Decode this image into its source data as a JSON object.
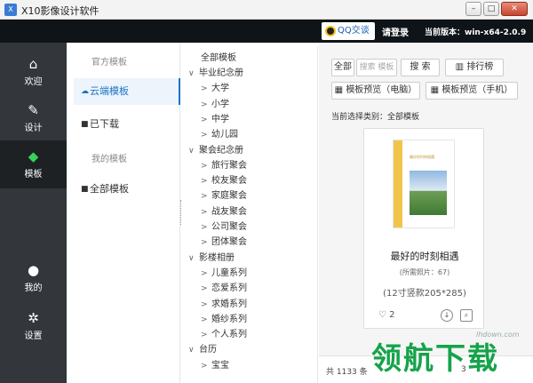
{
  "window": {
    "title": "X10影像设计软件",
    "app_icon": "X"
  },
  "header": {
    "qq_label": "QQ交谈",
    "login_label": "请登录",
    "version": "当前版本：win-x64-2.0.9"
  },
  "nav": {
    "items": [
      {
        "label": "欢迎",
        "icon": "home-icon"
      },
      {
        "label": "设计",
        "icon": "brush-icon"
      },
      {
        "label": "模板",
        "icon": "layers-icon",
        "active": true
      },
      {
        "label": "我的",
        "icon": "person-icon"
      },
      {
        "label": "设置",
        "icon": "gear-icon"
      }
    ]
  },
  "sidebar": {
    "official_title": "官方模板",
    "cloud": "云端模板",
    "downloaded": "已下载",
    "mine_title": "我的模板",
    "all": "全部模板"
  },
  "tree": {
    "root": "全部模板",
    "nodes": [
      {
        "label": "毕业纪念册",
        "level": 1,
        "arrow": "∨"
      },
      {
        "label": "大学",
        "level": 2,
        "arrow": ">"
      },
      {
        "label": "小学",
        "level": 2,
        "arrow": ">"
      },
      {
        "label": "中学",
        "level": 2,
        "arrow": ">"
      },
      {
        "label": "幼儿园",
        "level": 2,
        "arrow": ">"
      },
      {
        "label": "聚会纪念册",
        "level": 1,
        "arrow": "∨"
      },
      {
        "label": "旅行聚会",
        "level": 2,
        "arrow": ">"
      },
      {
        "label": "校友聚会",
        "level": 2,
        "arrow": ">"
      },
      {
        "label": "家庭聚会",
        "level": 2,
        "arrow": ">"
      },
      {
        "label": "战友聚会",
        "level": 2,
        "arrow": ">"
      },
      {
        "label": "公司聚会",
        "level": 2,
        "arrow": ">"
      },
      {
        "label": "团体聚会",
        "level": 2,
        "arrow": ">"
      },
      {
        "label": "影楼相册",
        "level": 1,
        "arrow": "∨"
      },
      {
        "label": "儿童系列",
        "level": 2,
        "arrow": ">"
      },
      {
        "label": "恋爱系列",
        "level": 2,
        "arrow": ">"
      },
      {
        "label": "求婚系列",
        "level": 2,
        "arrow": ">"
      },
      {
        "label": "婚纱系列",
        "level": 2,
        "arrow": ">"
      },
      {
        "label": "个人系列",
        "level": 2,
        "arrow": ">"
      },
      {
        "label": "台历",
        "level": 1,
        "arrow": "∨"
      },
      {
        "label": "宝宝",
        "level": 2,
        "arrow": ">"
      }
    ]
  },
  "toolbar": {
    "all": "全部",
    "search_placeholder": "搜索 模板",
    "search": "搜 索",
    "ranking": "排行榜",
    "preview_pc": "模板预览（电脑）",
    "preview_mobile": "模板预览（手机）"
  },
  "filter": {
    "label": "当前选择类别：全部模板"
  },
  "card": {
    "thumb_title": "最好的时刻相遇",
    "name": "最好的时刻相遇",
    "photo_count": "(所需照片：67)",
    "size": "(12寸竖款205*285)",
    "likes": "2"
  },
  "footer": {
    "total": "共 1133 条",
    "page": "3"
  },
  "watermark": {
    "site": "lhdown.com",
    "text": "领航下载"
  }
}
